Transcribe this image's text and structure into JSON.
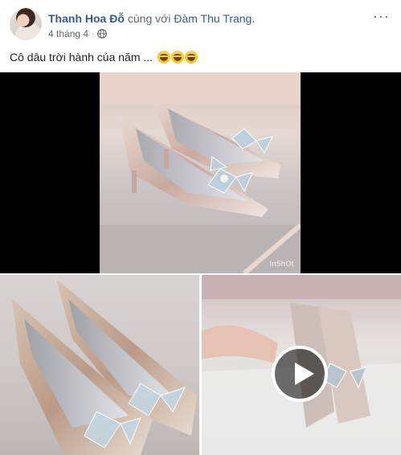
{
  "post": {
    "author": "Thanh Hoa Đỗ",
    "with_text": "cùng với",
    "tagged": "Đàm Thu Trang.",
    "date": "4 tháng 4",
    "separator": "·",
    "privacy_icon": "globe-icon",
    "more_icon": "more-options-icon",
    "more_glyph": "···",
    "text": "Cô dâu trời hành của năm ...",
    "emojis": [
      "grinning-sweat-emoji",
      "grinning-sweat-emoji",
      "grinning-sweat-emoji"
    ]
  },
  "media": {
    "main_photo": {
      "subject": "glitter silver heels with crystal flower",
      "watermark": "InShOt"
    },
    "thumbnails": [
      {
        "type": "photo"
      },
      {
        "type": "video",
        "play_icon": "play-icon"
      }
    ]
  },
  "colors": {
    "link": "#385898",
    "meta": "#606770",
    "text": "#1c1e21",
    "media_background": "#000000"
  }
}
